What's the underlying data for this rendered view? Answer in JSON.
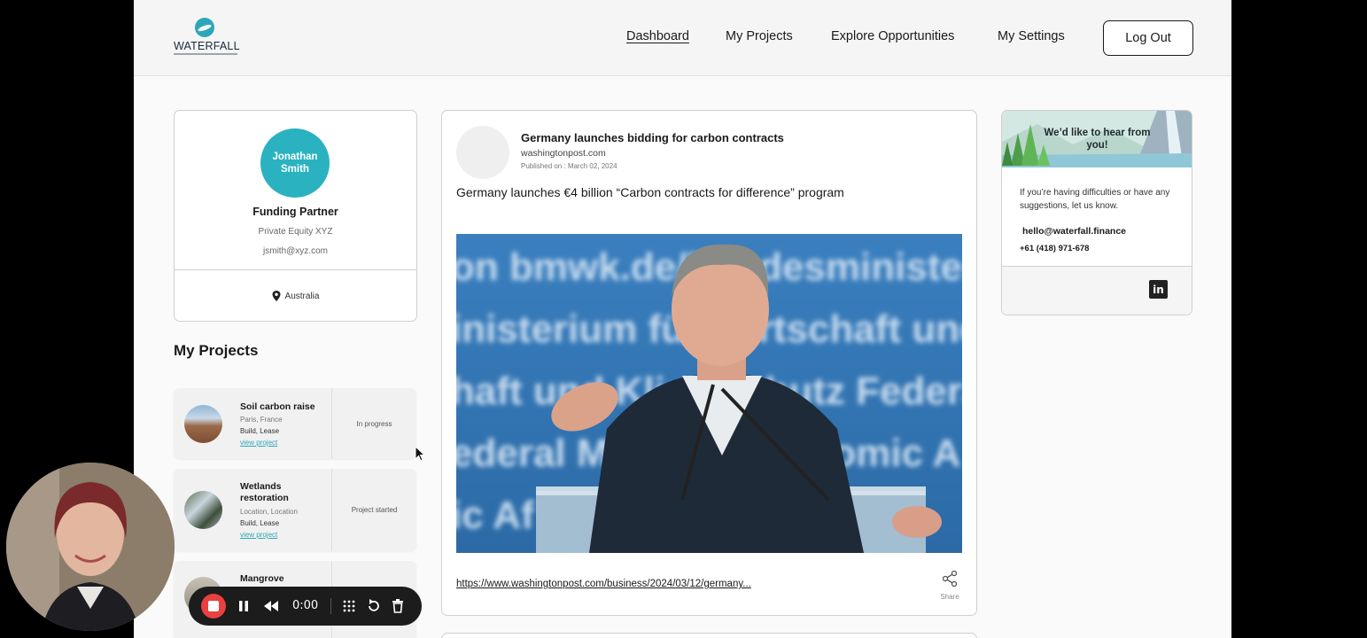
{
  "header": {
    "logo_text": "WATERFALL",
    "nav": [
      "Dashboard",
      "My Projects",
      "Explore Opportunities",
      "My Settings"
    ],
    "active_nav": "Dashboard",
    "logout_label": "Log Out"
  },
  "profile": {
    "avatar_initials_line1": "Jonathan",
    "avatar_initials_line2": "Smith",
    "role": "Funding Partner",
    "organization": "Private Equity XYZ",
    "email": "jsmith@xyz.com",
    "location": "Australia"
  },
  "projects": {
    "heading": "My Projects",
    "items": [
      {
        "name": "Soil carbon raise",
        "location": "Paris, France",
        "type": "Build, Lease",
        "link": "view project",
        "status": "In progress"
      },
      {
        "name": "Wetlands restoration",
        "location": "Location, Location",
        "type": "Build, Lease",
        "link": "view project",
        "status": "Project started"
      },
      {
        "name": "Mangrove",
        "location": "",
        "type": "",
        "link": "",
        "status": ""
      }
    ]
  },
  "news": {
    "headline": "Germany launches bidding for carbon contracts",
    "source": "washingtonpost.com",
    "published": "Published on : March 02, 2024",
    "summary": "Germany launches €4 billion “Carbon contracts for difference” program",
    "photo_alt": "Speaker at a podium",
    "url": "https://www.washingtonpost.com/business/2024/03/12/germany...",
    "share_label": "Share",
    "backdrop_text": [
      "on bmwk.de/bundesminister",
      "inisterium für Wirtschaft und",
      "haft und Klimaschutz  Federa",
      "ederal Ministry  Economic A",
      "ic Af"
    ]
  },
  "contact": {
    "banner_title": "We’d like to hear from you!",
    "text": "If you’re having difficulties or have any suggestions, let us know.",
    "email": "hello@waterfall.finance",
    "phone": "+61 (418) 971-678",
    "social": "in"
  },
  "recorder": {
    "timer": "0:00"
  },
  "colors": {
    "accent": "#2bb2c0",
    "record": "#e94040",
    "photo_bg": "#2f6fa8"
  }
}
